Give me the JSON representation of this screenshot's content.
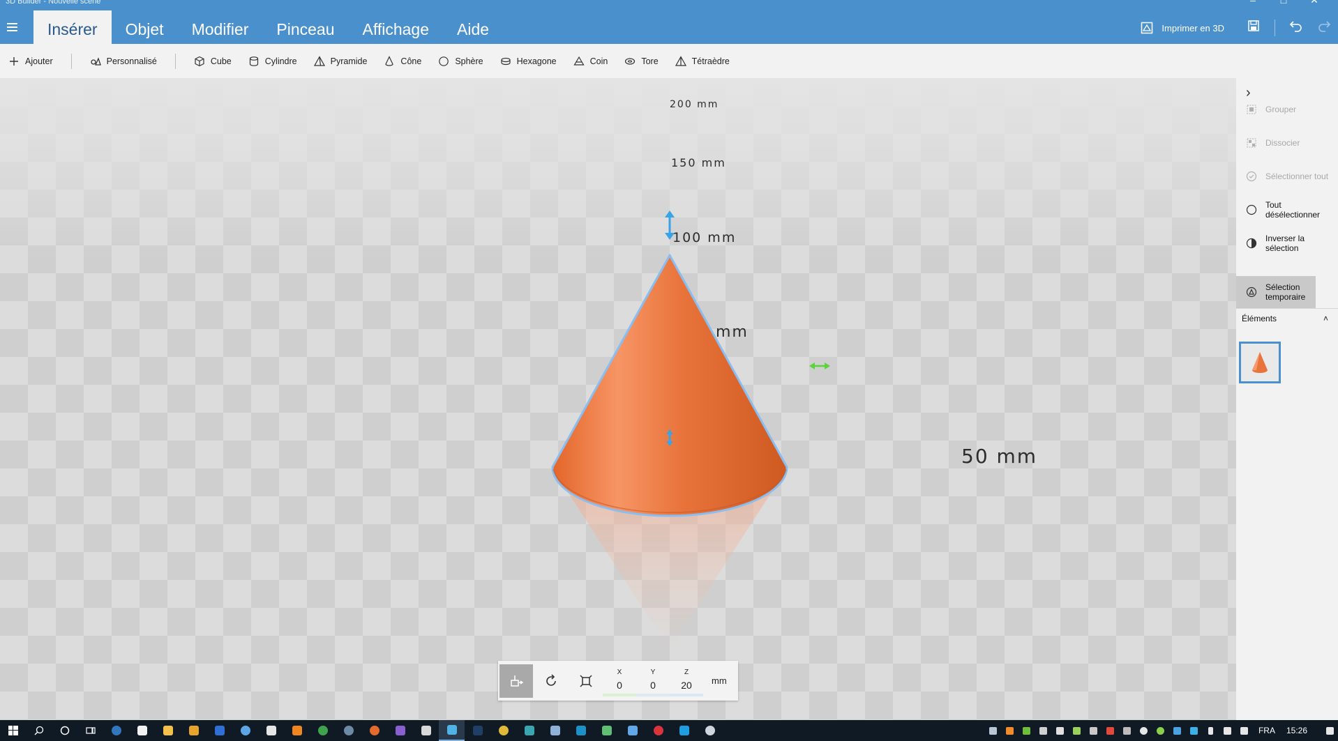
{
  "window": {
    "title": "3D Builder - Nouvelle scène"
  },
  "ribbon": {
    "tabs": [
      "Insérer",
      "Objet",
      "Modifier",
      "Pinceau",
      "Affichage",
      "Aide"
    ],
    "active_tab": "Insérer",
    "print_label": "Imprimer en 3D"
  },
  "toolbar": {
    "add_label": "Ajouter",
    "custom_label": "Personnalisé",
    "shapes": [
      "Cube",
      "Cylindre",
      "Pyramide",
      "Cône",
      "Sphère",
      "Hexagone",
      "Coin",
      "Tore",
      "Tétraèdre"
    ]
  },
  "viewport": {
    "scale_labels": [
      "200 mm",
      "150 mm",
      "100 mm",
      "mm",
      "50 mm"
    ],
    "object_color": "#e8743b",
    "highlight_color": "#8bbef0"
  },
  "panel": {
    "items": [
      {
        "label": "Grouper",
        "state": "disabled"
      },
      {
        "label": "Dissocier",
        "state": "disabled"
      },
      {
        "label": "Sélectionner tout",
        "state": "disabled"
      },
      {
        "label": "Tout désélectionner",
        "state": "normal"
      },
      {
        "label": "Inverser la sélection",
        "state": "normal"
      },
      {
        "label": "Sélection temporaire",
        "state": "active"
      }
    ],
    "elements_header": "Éléments"
  },
  "coords": {
    "x_label": "X",
    "x": "0",
    "y_label": "Y",
    "y": "0",
    "z_label": "Z",
    "z": "20",
    "unit": "mm"
  },
  "taskbar": {
    "language": "FRA",
    "time": "15:26"
  },
  "accent_color": "#4a90cc"
}
